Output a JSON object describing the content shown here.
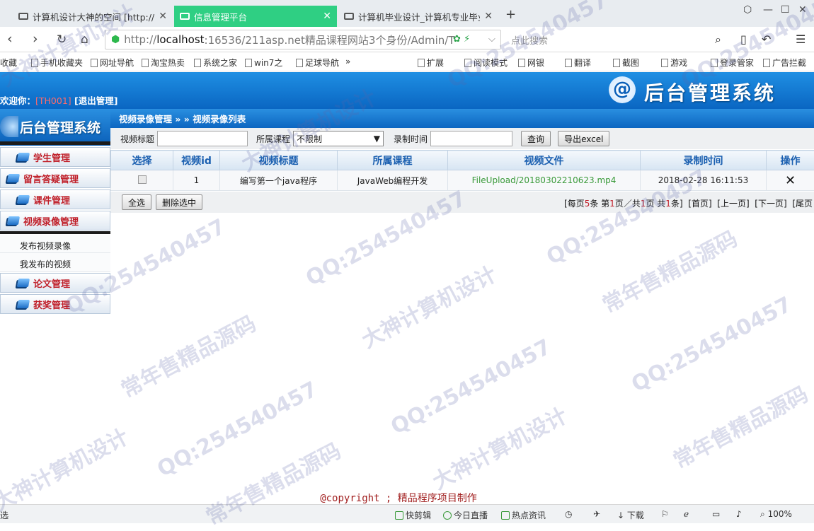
{
  "browser": {
    "tabs": [
      {
        "title": "计算机设计大神的空间 [http://2",
        "active": false
      },
      {
        "title": "信息管理平台",
        "active": true
      },
      {
        "title": "计算机毕业设计_计算机专业毕业",
        "active": false
      }
    ],
    "new_tab": "+",
    "url_scheme": "http://",
    "url_host": "localhost",
    "url_rest": ":16536/211asp.net精品课程网站3个身份/Admin/T",
    "search_placeholder": "点此搜索",
    "bookmarks": [
      "收藏",
      "手机收藏夹",
      "网址导航",
      "淘宝热卖",
      "系统之家",
      "win7之",
      "足球导航",
      "»"
    ],
    "toolbar_right": [
      "扩展",
      "阅读模式",
      "网银",
      "翻译",
      "截图",
      "游戏",
      "登录管家",
      "广告拦截"
    ],
    "accent": "#2fcf83"
  },
  "header": {
    "welcome_label": "欢迎你：",
    "user": "[TH001]",
    "logout": "[退出管理]",
    "logo_symbol": "@",
    "system_title": "后台管理系统"
  },
  "sidebar": {
    "title": "后台管理系统",
    "menu": [
      {
        "label": "学生管理"
      },
      {
        "label": "留言答疑管理"
      },
      {
        "label": "课件管理"
      },
      {
        "label": "视频录像管理"
      },
      {
        "label": "论文管理"
      },
      {
        "label": "获奖管理"
      }
    ],
    "submenu": [
      "发布视频录像",
      "我发布的视频"
    ]
  },
  "content": {
    "breadcrumb": "视频录像管理 » » 视频录像列表",
    "filter": {
      "title_label": "视频标题",
      "title_value": "",
      "course_label": "所属课程",
      "course_value": "不限制",
      "time_label": "录制时间",
      "time_value": "",
      "search_button": "查询",
      "export_button": "导出excel"
    },
    "table": {
      "headers": [
        "选择",
        "视频id",
        "视频标题",
        "所属课程",
        "视频文件",
        "录制时间",
        "操作"
      ],
      "rows": [
        {
          "id": "1",
          "title": "编写第一个java程序",
          "course": "JavaWeb编程开发",
          "file": "FileUpload/20180302210623.mp4",
          "time": "2018-02-28 16:11:53",
          "action": "✕"
        }
      ]
    },
    "select_all": "全选",
    "delete_selected": "删除选中",
    "pager": {
      "prefix": "[每页",
      "per_page": "5",
      "mid1": "条 第",
      "page": "1",
      "mid2": "页／共",
      "total_pages": "1",
      "mid3": "页 共",
      "total": "1",
      "suffix": "条]",
      "first": "[首页]",
      "prev": "[上一页]",
      "next": "[下一页]",
      "last": "[尾页"
    },
    "copyright": "@copyright ; 精品程序项目制作"
  },
  "statusbar": {
    "left": "选",
    "items": [
      "快剪辑",
      "今日直播",
      "热点资讯",
      "下载",
      "100%"
    ]
  },
  "watermarks": [
    "QQ:254540457",
    "常年售精品源码",
    "大神计算机设计"
  ]
}
